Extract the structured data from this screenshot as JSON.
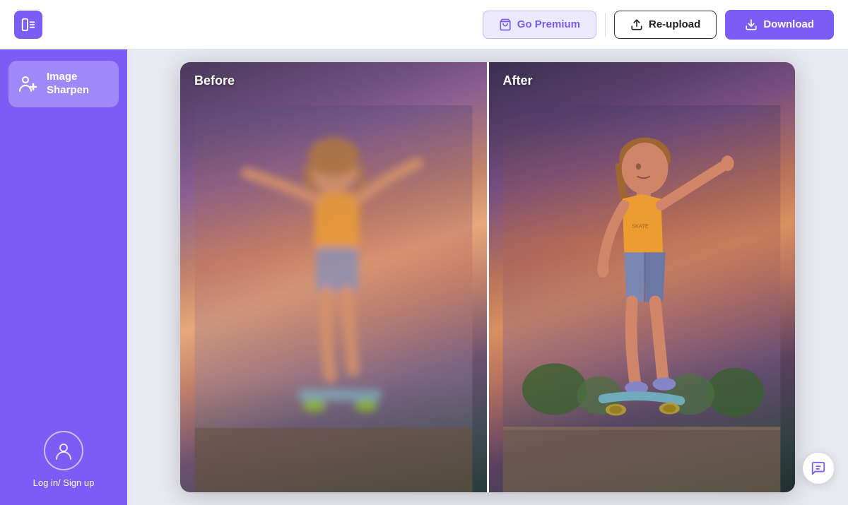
{
  "header": {
    "premium_label": "Go Premium",
    "reupload_label": "Re-upload",
    "download_label": "Download"
  },
  "sidebar": {
    "active_item": {
      "label_line1": "Image",
      "label_line2": "Sharpen",
      "label": "Image\nSharpen"
    },
    "login_label": "Log in/ Sign up"
  },
  "content": {
    "before_label": "Before",
    "after_label": "After"
  },
  "colors": {
    "purple": "#7b5cf5",
    "purple_light": "#ede9ff",
    "purple_border": "#c4b5ff"
  }
}
